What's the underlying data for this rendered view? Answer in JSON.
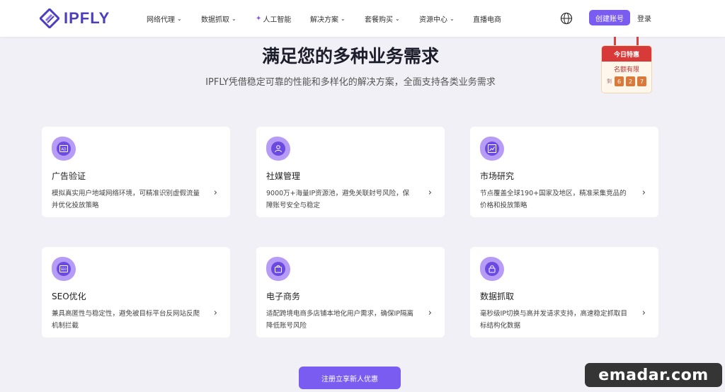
{
  "header": {
    "logo_text": "IPFLY",
    "nav": [
      {
        "label": "网络代理",
        "has_chevron": true
      },
      {
        "label": "数据抓取",
        "has_chevron": true
      },
      {
        "label": "人工智能",
        "has_chevron": false
      },
      {
        "label": "解决方案",
        "has_chevron": true
      },
      {
        "label": "套餐购买",
        "has_chevron": true
      },
      {
        "label": "资源中心",
        "has_chevron": true
      },
      {
        "label": "直播电商",
        "has_chevron": false
      }
    ],
    "signup_label": "创建账号",
    "login_label": "登录"
  },
  "hero": {
    "title": "满足您的多种业务需求",
    "subtitle": "IPFLY凭借稳定可靠的性能和多样化的解决方案，全面支持各类业务需求"
  },
  "promo": {
    "banner": "今日特惠",
    "subline": "名额有限",
    "digits_label": "剩",
    "digits": [
      "6",
      "2",
      "7"
    ]
  },
  "cards": [
    {
      "title": "广告验证",
      "desc": "模拟真实用户地域网络环境，可精准识别虚假流量并优化投放策略",
      "icon": "ad-icon"
    },
    {
      "title": "社媒管理",
      "desc": "9000万+海量IP资源池，避免关联封号风险，保障账号安全与稳定",
      "icon": "user-icon"
    },
    {
      "title": "市场研究",
      "desc": "节点覆盖全球190+国家及地区，精准采集竞品的价格和投放策略",
      "icon": "chart-icon"
    },
    {
      "title": "SEO优化",
      "desc": "兼具高匿性与稳定性，避免被目标平台反网站反爬机制拦截",
      "icon": "seo-icon"
    },
    {
      "title": "电子商务",
      "desc": "适配跨境电商多店铺本地化用户需求，确保IP隔离降低账号风险",
      "icon": "shop-icon"
    },
    {
      "title": "数据抓取",
      "desc": "毫秒级IP切换与高并发请求支持，高速稳定抓取目标结构化数据",
      "icon": "lock-icon"
    }
  ],
  "cta_label": "注册立享新人优惠",
  "watermark": "emadar.com",
  "colors": {
    "accent": "#7b5cf0",
    "brand": "#4b3fbf",
    "background": "#f1f0f6",
    "promo_red": "#d83a3a"
  }
}
